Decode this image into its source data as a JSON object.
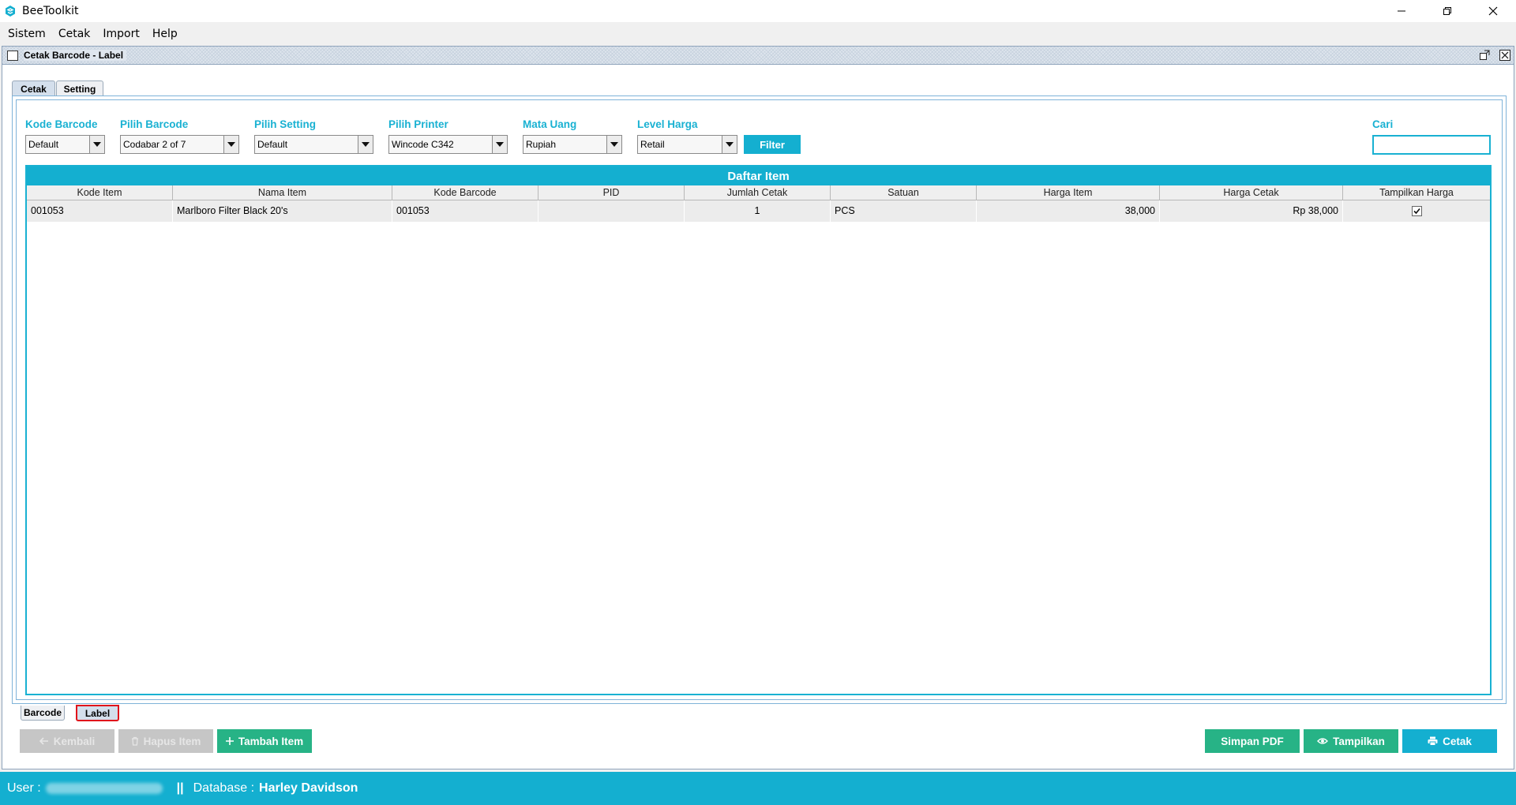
{
  "app": {
    "title": "BeeToolkit",
    "brand_color": "#14afd0"
  },
  "menu": [
    "Sistem",
    "Cetak",
    "Import",
    "Help"
  ],
  "frame": {
    "title": "Cetak Barcode - Label"
  },
  "top_tabs": [
    {
      "label": "Cetak",
      "active": true
    },
    {
      "label": "Setting",
      "active": false
    }
  ],
  "filters": {
    "kode_barcode": {
      "label": "Kode Barcode",
      "value": "Default"
    },
    "pilih_barcode": {
      "label": "Pilih Barcode",
      "value": "Codabar 2 of 7"
    },
    "pilih_setting": {
      "label": "Pilih Setting",
      "value": "Default"
    },
    "pilih_printer": {
      "label": "Pilih Printer",
      "value": "Wincode C342"
    },
    "mata_uang": {
      "label": "Mata Uang",
      "value": "Rupiah"
    },
    "level_harga": {
      "label": "Level Harga",
      "value": "Retail"
    },
    "filter_button": "Filter",
    "cari": {
      "label": "Cari",
      "value": ""
    }
  },
  "table": {
    "title": "Daftar Item",
    "columns": [
      "Kode Item",
      "Nama Item",
      "Kode Barcode",
      "PID",
      "Jumlah Cetak",
      "Satuan",
      "Harga Item",
      "Harga Cetak",
      "Tampilkan Harga"
    ],
    "rows": [
      {
        "kode_item": "001053",
        "nama_item": "Marlboro Filter Black 20's",
        "kode_barcode": "001053",
        "pid": "",
        "jumlah_cetak": "1",
        "satuan": "PCS",
        "harga_item": "38,000",
        "harga_cetak": "Rp 38,000",
        "tampilkan_harga": true
      }
    ]
  },
  "bottom_tabs": [
    {
      "label": "Barcode",
      "active": false
    },
    {
      "label": "Label",
      "active": true
    }
  ],
  "actions": {
    "kembali": "Kembali",
    "hapus_item": "Hapus Item",
    "tambah_item": "Tambah Item",
    "simpan_pdf": "Simpan PDF",
    "tampilkan": "Tampilkan",
    "cetak": "Cetak"
  },
  "status": {
    "user_label": "User :",
    "separator": "||",
    "database_label": "Database :",
    "database_name": "Harley Davidson"
  }
}
